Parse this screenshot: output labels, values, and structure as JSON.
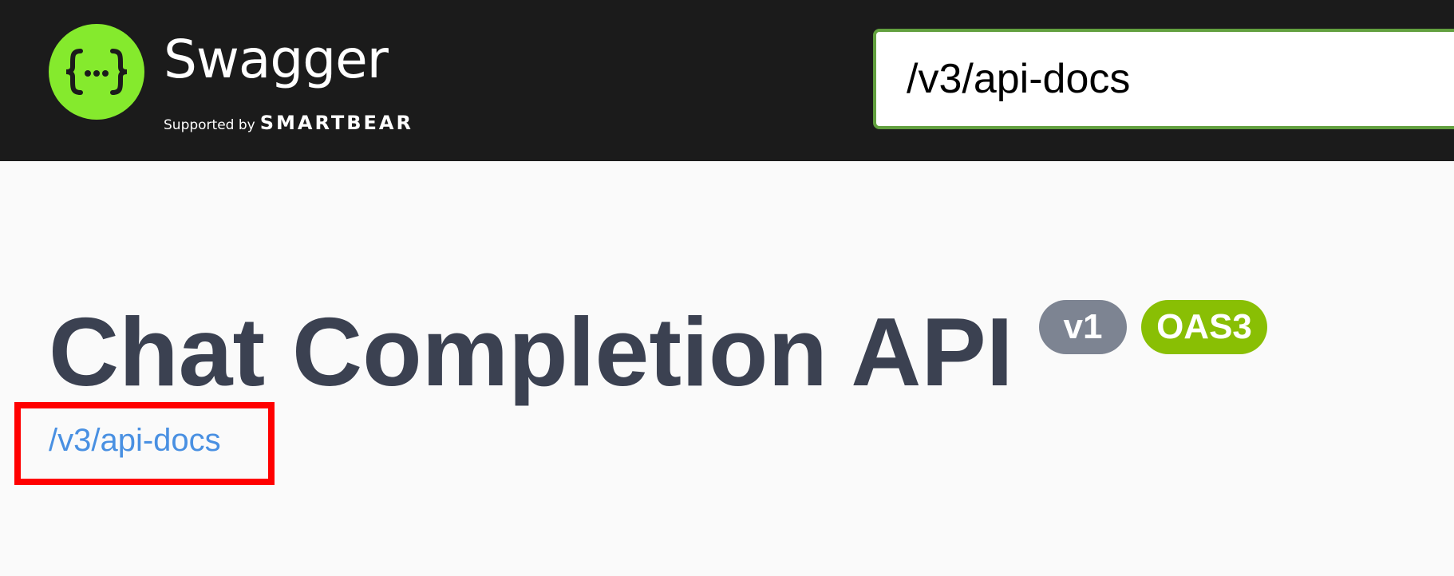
{
  "topbar": {
    "logo": {
      "icon": "swagger-braces-icon",
      "brand": "Swagger",
      "supported_by": "Supported by",
      "company": "SMARTBEAR"
    },
    "url_input": {
      "value": "/v3/api-docs"
    }
  },
  "info": {
    "title": "Chat Completion API",
    "version_badge": "v1",
    "oas_badge": "OAS3",
    "spec_link": "/v3/api-docs"
  },
  "colors": {
    "topbar_bg": "#1b1b1b",
    "logo_green": "#85ea2d",
    "input_border": "#62a03f",
    "title": "#3b4151",
    "version_badge": "#7d8492",
    "oas_badge": "#89bf04",
    "link": "#4990e2",
    "highlight": "#ff0000"
  }
}
